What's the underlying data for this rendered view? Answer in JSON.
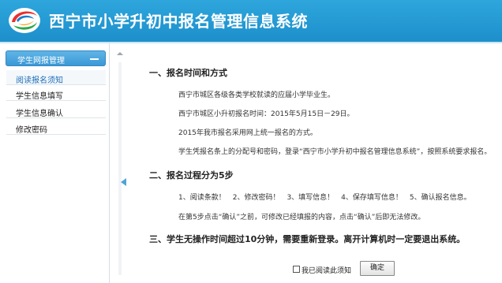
{
  "header": {
    "title": "西宁市小学升初中报名管理信息系统",
    "background": "#2196d3"
  },
  "sidebar": {
    "group_label": "学生网报管理",
    "items": [
      {
        "label": "阅读报名须知",
        "active": true
      },
      {
        "label": "学生信息填写",
        "active": false
      },
      {
        "label": "学生信息确认",
        "active": false
      },
      {
        "label": "修改密码",
        "active": false
      }
    ]
  },
  "notice": {
    "section1": {
      "title": "一、报名时间和方式",
      "lines": [
        "西宁市城区各级各类学校就读的应届小学毕业生。",
        "西宁市城区小升初报名时间：2015年5月15日－29日。",
        "2015年我市报名采用网上统一报名的方式。",
        "学生凭报名条上的分配号和密码，登录“西宁市小学升初中报名管理信息系统”，按照系统要求报名。"
      ]
    },
    "section2": {
      "title": "二、报名过程分为5步",
      "steps": "1、阅读条款！　2、修改密码！　3、填写信息！　4、保存填写信息！　5、确认报名信息。",
      "note": "在第5步点击“确认”之前，可修改已经填报的内容，点击“确认”后即无法修改。"
    },
    "section3": {
      "title": "三、学生无操作时间超过10分钟，需要重新登录。离开计算机时一定要退出系统。"
    }
  },
  "footer": {
    "agree_label": "我已阅读此须知",
    "confirm_label": "确定"
  }
}
